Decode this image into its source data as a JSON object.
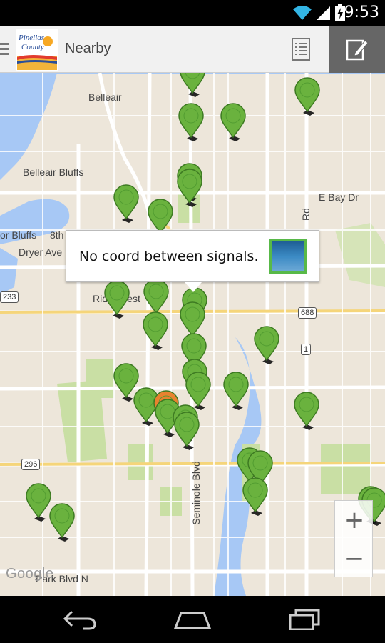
{
  "status_bar": {
    "time": "9:53",
    "icons": [
      "wifi-icon",
      "signal-icon",
      "battery-charging-icon"
    ]
  },
  "action_bar": {
    "logo_text": "Pinellas County",
    "title": "Nearby",
    "list_icon": "list-icon",
    "compose_icon": "compose-icon"
  },
  "map": {
    "labels": {
      "belleair": "Belleair",
      "belleair_bluffs": "Belleair Bluffs",
      "bor_bluffs": "or Bluffs",
      "eighth": "8th",
      "dryer_ave": "Dryer Ave",
      "ridgecrest": "Ridgecrest",
      "e_bay_dr": "E Bay Dr",
      "rd": "Rd",
      "seminole_blvd": "Seminole Blvd",
      "park_blvd": "Park Blvd N"
    },
    "shields": {
      "r233": "233",
      "r688": "688",
      "r1": "1",
      "r296": "296"
    },
    "callout": {
      "text": "No coord between signals."
    },
    "zoom_in": "+",
    "zoom_out": "−",
    "attribution": "Google",
    "marker_colors": {
      "active": "#6ab23e",
      "selected": "#e8822f"
    }
  },
  "nav_bar": {
    "back": "back-icon",
    "home": "home-icon",
    "recents": "recents-icon"
  }
}
